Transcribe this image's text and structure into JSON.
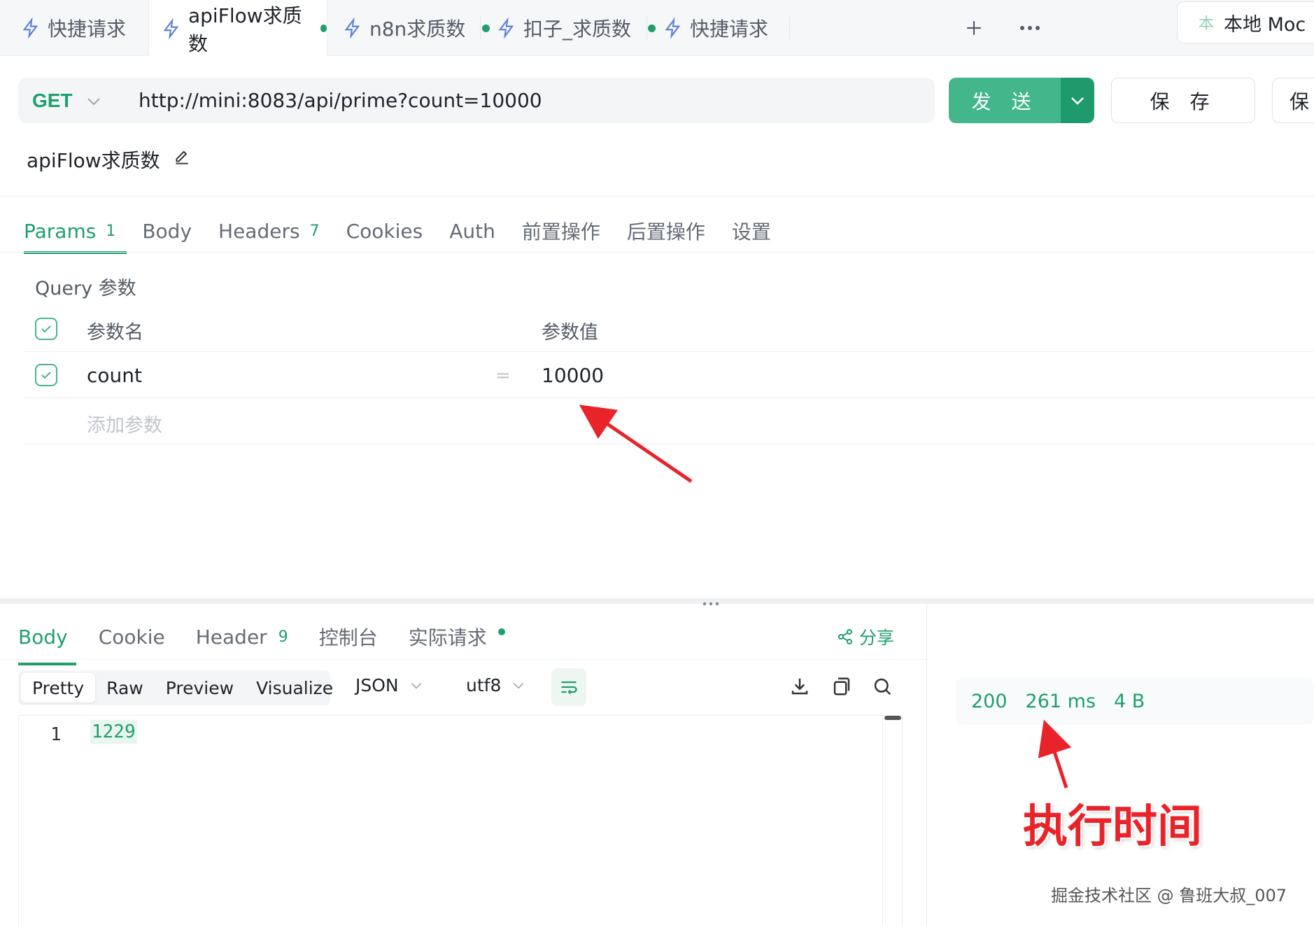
{
  "tabs": [
    {
      "label": "快捷请求",
      "dirty": false,
      "active": false
    },
    {
      "label": "apiFlow求质数",
      "dirty": true,
      "active": true
    },
    {
      "label": "n8n求质数",
      "dirty": true,
      "active": false
    },
    {
      "label": "扣子_求质数",
      "dirty": true,
      "active": false
    },
    {
      "label": "快捷请求",
      "dirty": false,
      "active": false
    }
  ],
  "tab_actions": {
    "add_icon": "plus-icon",
    "more_icon": "ellipsis-icon"
  },
  "environment": {
    "badge": "本",
    "label": "本地 Moc"
  },
  "request": {
    "method": "GET",
    "url": "http://mini:8083/api/prime?count=10000",
    "name": "apiFlow求质数",
    "send_label": "发 送",
    "save_label": "保 存",
    "save_as_label": "保存"
  },
  "request_tabs": [
    {
      "label": "Params",
      "count": "1",
      "active": true
    },
    {
      "label": "Body",
      "count": "",
      "active": false
    },
    {
      "label": "Headers",
      "count": "7",
      "active": false
    },
    {
      "label": "Cookies",
      "count": "",
      "active": false
    },
    {
      "label": "Auth",
      "count": "",
      "active": false
    },
    {
      "label": "前置操作",
      "count": "",
      "active": false
    },
    {
      "label": "后置操作",
      "count": "",
      "active": false
    },
    {
      "label": "设置",
      "count": "",
      "active": false
    }
  ],
  "params": {
    "section_title": "Query 参数",
    "header_name": "参数名",
    "header_value": "参数值",
    "rows": [
      {
        "name": "count",
        "separator": "=",
        "value": "10000",
        "enabled": true
      }
    ],
    "add_placeholder": "添加参数"
  },
  "response_tabs": [
    {
      "label": "Body",
      "count": "",
      "active": true
    },
    {
      "label": "Cookie",
      "count": "",
      "active": false
    },
    {
      "label": "Header",
      "count": "9",
      "active": false
    },
    {
      "label": "控制台",
      "count": "",
      "active": false
    },
    {
      "label": "实际请求",
      "count": "",
      "active": false,
      "indicator": true
    }
  ],
  "share_label": "分享",
  "view_modes": [
    "Pretty",
    "Raw",
    "Preview",
    "Visualize"
  ],
  "active_view_mode": "Pretty",
  "format": "JSON",
  "encoding": "utf8",
  "response_body": {
    "line_number": "1",
    "content": "1229"
  },
  "status": {
    "code": "200",
    "time": "261 ms",
    "size": "4 B"
  },
  "annotation": {
    "label": "执行时间",
    "color": "#e8242a"
  },
  "watermark": "掘金技术社区 @ 鲁班大叔_007",
  "colors": {
    "accent": "#1f9f6e",
    "send": "#43b78b",
    "send_dropdown": "#1e9a6c"
  }
}
